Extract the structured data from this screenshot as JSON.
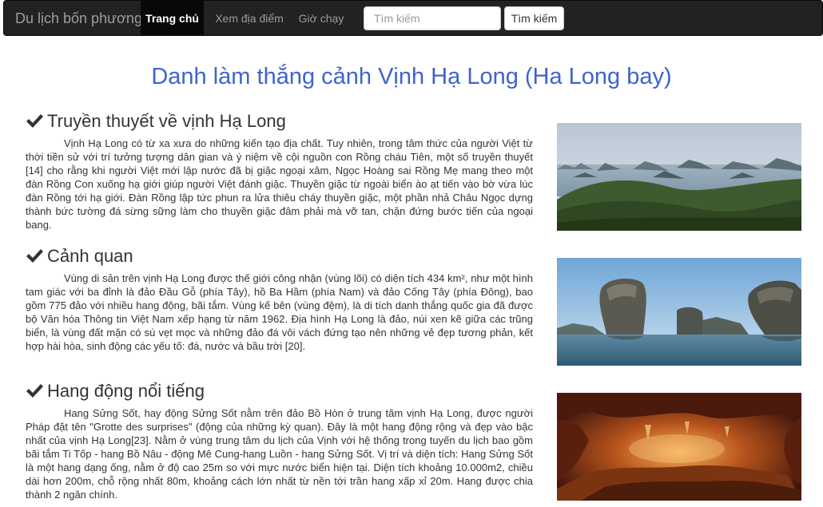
{
  "navbar": {
    "brand": "Du lịch bốn phương",
    "items": [
      {
        "label": "Trang chủ",
        "active": true
      },
      {
        "label": "Xem địa điểm",
        "active": false
      },
      {
        "label": "Giờ chạy",
        "active": false
      }
    ],
    "search_placeholder": "Tìm kiếm",
    "search_button": "Tìm kiếm"
  },
  "page": {
    "title": "Danh làm thắng cảnh Vịnh Hạ Long (Ha Long bay)"
  },
  "sections": [
    {
      "icon": "checkmark-icon",
      "heading": "Truyền thuyết về vịnh Hạ Long",
      "text": "Vịnh Hạ Long có từ xa xưa do những kiến tạo địa chất. Tuy nhiên, trong tâm thức của người Việt từ thời tiền sử với trí tưởng tượng dân gian và ý niệm về cội nguồn con Rồng cháu Tiên, một số truyền thuyết [14] cho rằng khi người Việt mới lập nước đã bị giặc ngoại xâm, Ngọc Hoàng sai Rồng Mẹ mang theo một đàn Rồng Con xuống hạ giới giúp người Việt đánh giặc. Thuyền giặc từ ngoài biển ào ạt tiến vào bờ vừa lúc đàn Rồng tới hạ giới. Đàn Rồng lập tức phun ra lửa thiêu cháy thuyền giặc, một phần nhả Châu Ngọc dựng thành bức tường đá sừng sững làm cho thuyền giặc đâm phải mà vỡ tan, chặn đứng bước tiến của ngoại bang.",
      "image": "halong-bay-islands-photo"
    },
    {
      "icon": "checkmark-icon",
      "heading": "Cảnh quan",
      "text": "Vùng di sản trên vịnh Hạ Long được thế giới công nhận (vùng lõi) có diện tích 434 km², như một hình tam giác với ba đỉnh là đảo Đầu Gỗ (phía Tây), hồ Ba Hầm (phía Nam) và đảo Cống Tây (phía Đông), bao gồm 775 đảo với nhiều hang động, bãi tắm. Vùng kế bên (vùng đệm), là di tích danh thắng quốc gia đã được bộ Văn hóa Thông tin Việt Nam xếp hạng từ năm 1962. Địa hình Hạ Long là đảo, núi xen kẽ giữa các trũng biển, là vùng đất mặn có sú vẹt mọc và những đảo đá vôi vách đứng tạo nên những vẻ đẹp tương phản, kết hợp hài hòa, sinh động các yếu tố: đá, nước và bầu trời [20].",
      "image": "limestone-rocks-photo"
    },
    {
      "icon": "checkmark-icon",
      "heading": "Hang động nổi tiếng",
      "text": "Hang Sửng Sốt, hay động Sửng Sốt nằm trên đảo Bồ Hòn ở trung tâm vịnh Hạ Long, được người Pháp đặt tên \"Grotte des surprises\" (động của những kỳ quan). Đây là một hang động rộng và đẹp vào bậc nhất của vịnh Hạ Long[23]. Nằm ở vùng trung tâm du lịch của Vịnh với hệ thống trong tuyến du lịch bao gồm bãi tắm Ti Tốp - hang Bồ Nâu - động Mê Cung-hang Luồn - hang Sửng Sốt. Vị trí và diện tích: Hang Sửng Sốt là một hang dạng ống, nằm ở độ cao 25m so với mực nước biển hiện tại. Diện tích khoảng 10.000m2, chiều dài hơn 200m, chỗ rộng nhất 80m, khoảng cách lớn nhất từ nền tới trần hang xấp xỉ 20m. Hang được chia thành 2 ngăn chính.",
      "image": "sung-sot-cave-photo"
    }
  ],
  "colors": {
    "navbar_bg": "#222222",
    "title": "#3f63cf",
    "text": "#333333"
  }
}
